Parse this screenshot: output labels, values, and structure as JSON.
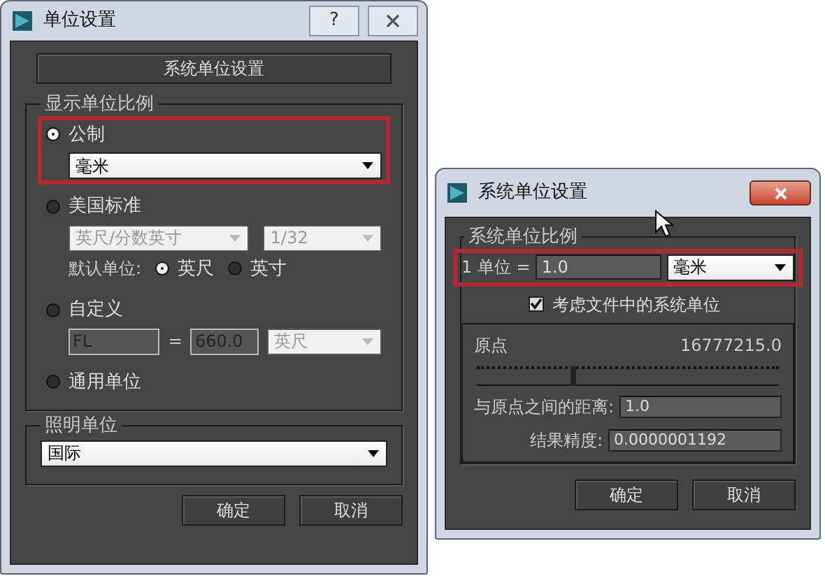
{
  "unit_setup": {
    "title": "单位设置",
    "help_button": "?",
    "system_unit_button": "系统单位设置",
    "display_scale": {
      "title": "显示单位比例",
      "options": [
        {
          "kind": "metric",
          "label": "公制",
          "selected": true,
          "highlighted": true,
          "dropdown": {
            "value": "毫米",
            "disabled": false
          }
        },
        {
          "kind": "us",
          "label": "美国标准",
          "selected": false,
          "dropdowns": [
            {
              "value": "英尺/分数英寸",
              "disabled": true
            },
            {
              "value": "1/32",
              "disabled": true
            }
          ],
          "default_unit": {
            "label": "默认单位:",
            "choices": [
              {
                "label": "英尺",
                "selected": true
              },
              {
                "label": "英寸",
                "selected": false
              }
            ]
          }
        },
        {
          "kind": "custom",
          "label": "自定义",
          "selected": false,
          "name_field": {
            "value": "FL",
            "disabled": true
          },
          "equals": "=",
          "value_field": {
            "value": "660.0",
            "disabled": true
          },
          "unit_dropdown": {
            "value": "英尺",
            "disabled": true
          }
        },
        {
          "kind": "generic",
          "label": "通用单位",
          "selected": false
        }
      ]
    },
    "lighting": {
      "title": "照明单位",
      "dropdown": {
        "value": "国际",
        "disabled": false
      }
    },
    "buttons": [
      "确定",
      "取消"
    ]
  },
  "system_unit_setup": {
    "title": "系统单位设置",
    "scale": {
      "title": "系统单位比例",
      "highlighted": true,
      "label": "1 单位 =",
      "value": "1.0",
      "unit": "毫米",
      "consider_file": {
        "label": "考虑文件中的系统单位",
        "checked": true
      }
    },
    "origin": {
      "label": "原点",
      "value": "16777215.0",
      "slider": {
        "level": 0.32
      },
      "distance": {
        "label": "与原点之间的距离:",
        "value": "1.0"
      },
      "precision": {
        "label": "结果精度:",
        "value": "0.0000001192"
      }
    },
    "buttons": [
      "确定",
      "取消"
    ]
  }
}
